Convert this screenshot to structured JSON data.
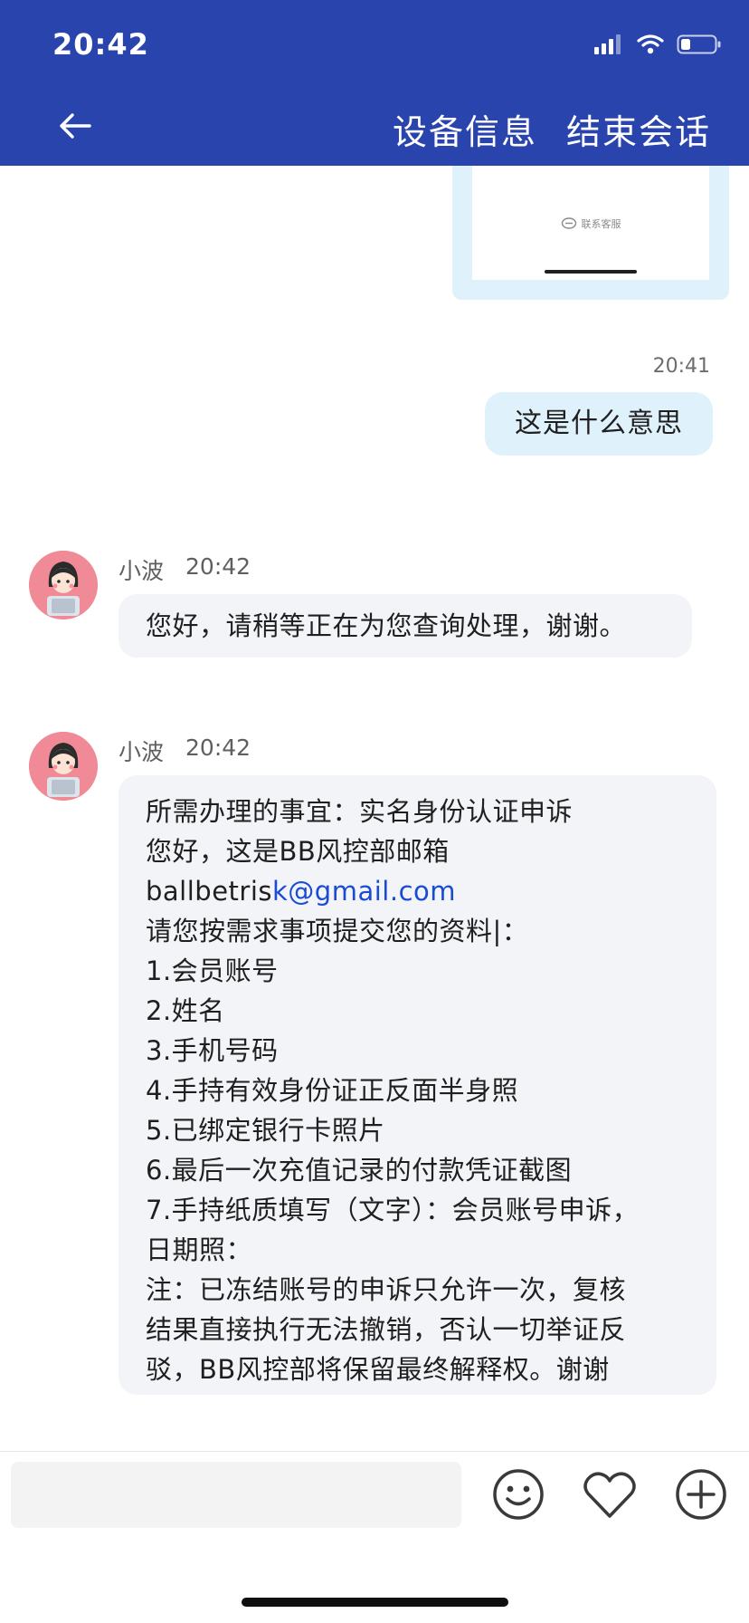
{
  "status_bar": {
    "time": "20:42"
  },
  "header": {
    "device_info_label": "设备信息",
    "end_session_label": "结束会话"
  },
  "messages": {
    "image_card": {
      "caption": "联系客服"
    },
    "outgoing": {
      "time": "20:41",
      "text": "这是什么意思"
    },
    "incoming_1": {
      "sender": "小波",
      "time": "20:42",
      "text": "您好，请稍等正在为您查询处理，谢谢。"
    },
    "incoming_2": {
      "sender": "小波",
      "time": "20:42",
      "line1": "所需办理的事宜：实名身份认证申诉",
      "line2": "您好，这是BB风控部邮箱",
      "email_prefix": "ballbetris",
      "email_link": "k@gmail.com",
      "line4": "请您按需求事项提交您的资料|：",
      "line5": "1.会员账号",
      "line6": "2.姓名",
      "line7": "3.手机号码",
      "line8": "4.手持有效身份证正反面半身照",
      "line9": "5.已绑定银行卡照片",
      "line10": "6.最后一次充值记录的付款凭证截图",
      "line11": "7.手持纸质填写（文字）：会员账号申诉，",
      "line12": "日期照：",
      "line13": "注：已冻结账号的申诉只允许一次，复核",
      "line14": "结果直接执行无法撤销，否认一切举证反",
      "line15": "驳，BB风控部将保留最终解释权。谢谢"
    }
  },
  "input_bar": {
    "value": "",
    "placeholder": ""
  },
  "colors": {
    "header_bg": "#2a44ae",
    "outgoing_bubble": "#dff1fb",
    "incoming_bubble": "#f3f4f8",
    "link": "#1a4bd3",
    "avatar_bg": "#f08a96"
  },
  "icons": {
    "back": "arrow-left-icon",
    "emoji": "smiley-icon",
    "favorite": "heart-icon",
    "more": "plus-circle-icon",
    "signal": "cellular-signal-icon",
    "wifi": "wifi-icon",
    "battery": "battery-icon"
  }
}
